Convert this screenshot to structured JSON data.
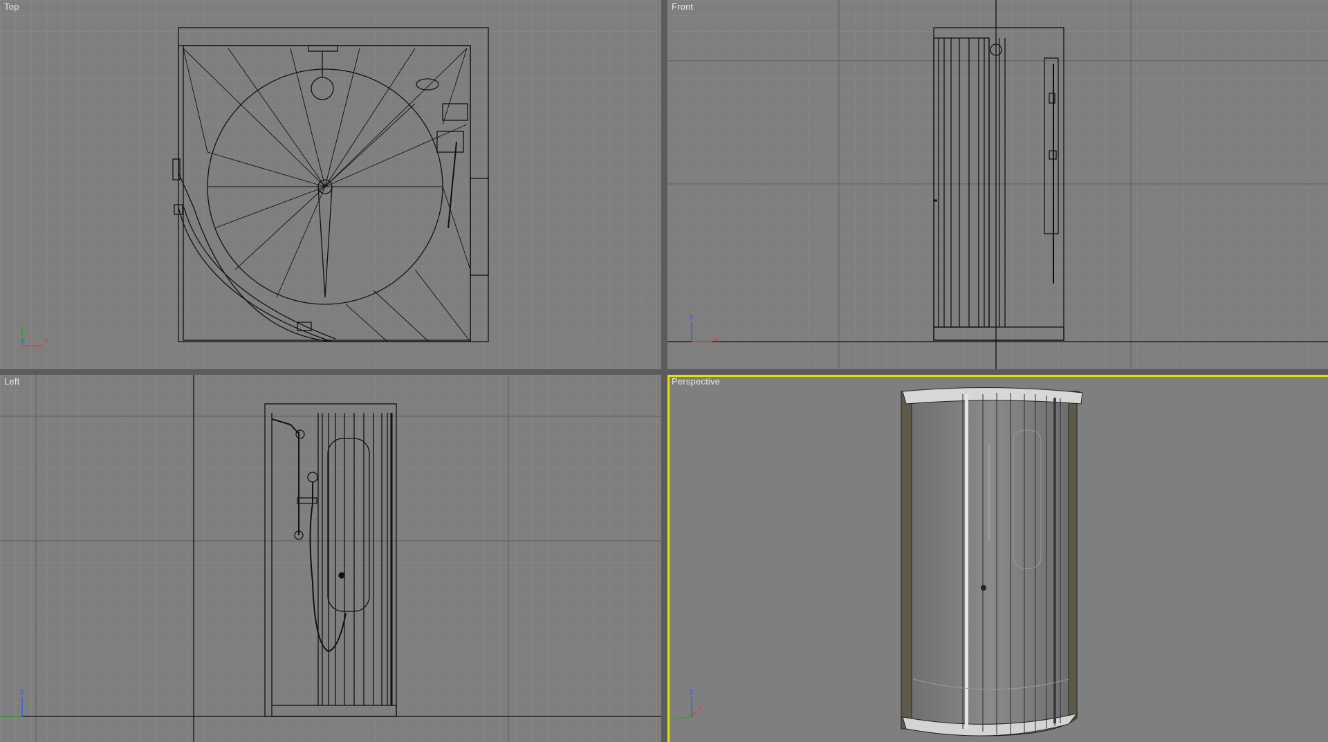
{
  "viewports": {
    "top": {
      "label": "Top",
      "axis_h": "x",
      "axis_v": "z"
    },
    "front": {
      "label": "Front",
      "axis_h": "x",
      "axis_v": "z"
    },
    "left": {
      "label": "Left",
      "axis_h": "x",
      "axis_v": "z"
    },
    "perspective": {
      "label": "Perspective",
      "axis_h": "x",
      "axis_v": "z",
      "active": true
    }
  },
  "colors": {
    "background": "#7f7f7f",
    "grid": "#8c8c8c",
    "grid_major": "#000000",
    "wireframe": "#111111",
    "active_border": "#e8e000",
    "axis_x": "#e83a3a",
    "axis_y": "#3ad03a",
    "axis_z": "#3a5ae8"
  },
  "icons": [
    "axis-tripod-icon"
  ]
}
